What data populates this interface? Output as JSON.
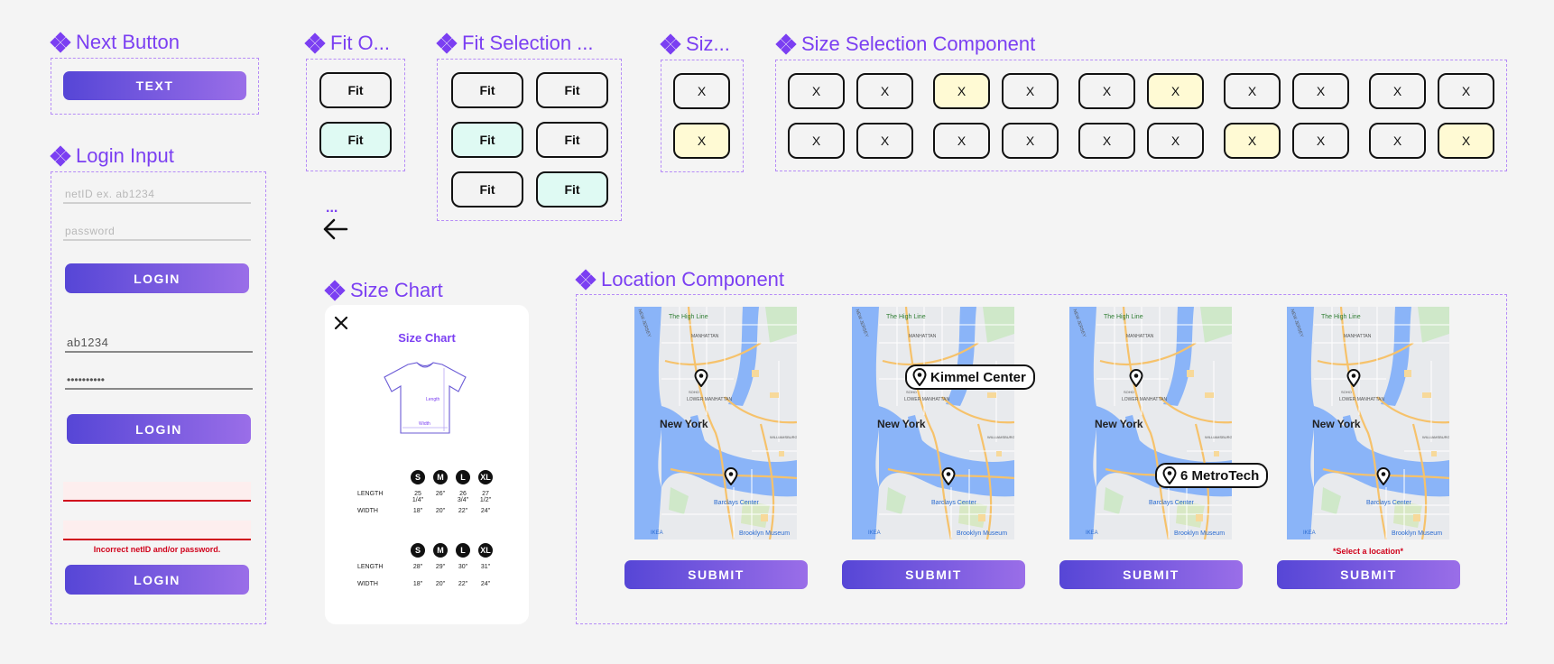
{
  "sections": {
    "next_button": "Next Button",
    "fit_option": "Fit O...",
    "fit_selection": "Fit Selection ...",
    "size_option": "Siz...",
    "size_selection": "Size Selection Component",
    "login_input": "Login Input",
    "size_chart": "Size Chart",
    "location": "Location Component"
  },
  "next_button": {
    "label": "TEXT"
  },
  "login": {
    "netid_placeholder": "netID ex. ab1234",
    "password_placeholder": "password",
    "login_label": "LOGIN",
    "filled_netid": "ab1234",
    "filled_password": "••••••••••",
    "error_text": "Incorrect netID and/or password."
  },
  "fit": {
    "label": "Fit",
    "option_states": [
      "default",
      "selected"
    ],
    "selection_states": [
      "default",
      "default",
      "selected",
      "default",
      "default",
      "selected"
    ]
  },
  "size": {
    "label": "X",
    "option_states": [
      "default",
      "selected"
    ],
    "grid_rows": [
      [
        "default",
        "default",
        "selected",
        "default",
        "default",
        "selected",
        "default",
        "default",
        "default",
        "default"
      ],
      [
        "default",
        "default",
        "default",
        "default",
        "default",
        "default",
        "selected",
        "default",
        "default",
        "selected"
      ]
    ]
  },
  "nav": {
    "dots": "...",
    "back_icon": "arrow-left-icon"
  },
  "size_chart": {
    "title": "Size Chart",
    "shirt_length_label": "Length",
    "shirt_width_label": "Width",
    "tables": [
      {
        "sizes": [
          "S",
          "M",
          "L",
          "XL"
        ],
        "rows": [
          {
            "label": "LENGTH",
            "values": [
              "25 1/4\"",
              "26\"",
              "26 3/4\"",
              "27 1/2\""
            ]
          },
          {
            "label": "WIDTH",
            "values": [
              "18\"",
              "20\"",
              "22\"",
              "24\""
            ]
          }
        ]
      },
      {
        "sizes": [
          "S",
          "M",
          "L",
          "XL"
        ],
        "rows": [
          {
            "label": "LENGTH",
            "values": [
              "28\"",
              "29\"",
              "30\"",
              "31\""
            ]
          },
          {
            "label": "WIDTH",
            "values": [
              "18\"",
              "20\"",
              "22\"",
              "24\""
            ]
          }
        ]
      }
    ]
  },
  "location": {
    "submit_label": "SUBMIT",
    "map_labels": {
      "city": "New York",
      "high_line": "The High Line",
      "manhattan": "MANHATTAN",
      "soho": "SOHO",
      "lower_manhattan": "LOWER MANHATTAN",
      "barclays": "Barclays Center",
      "brooklyn_museum": "Brooklyn Museum",
      "ikea": "IKEA",
      "williamsburg": "WILLIAMSBURG",
      "new_jersey": "NEW JERSEY"
    },
    "callouts": [
      "Kimmel Center",
      "6 MetroTech"
    ],
    "error_text": "*Select a location*"
  },
  "colors": {
    "accent": "#7b3ff2",
    "button_gradient_start": "#5646d6",
    "button_gradient_end": "#9a6ee8",
    "selected_fit": "#dffaf3",
    "selected_size": "#fffad4",
    "error": "#d0021b",
    "error_bg": "#fdeeee"
  }
}
